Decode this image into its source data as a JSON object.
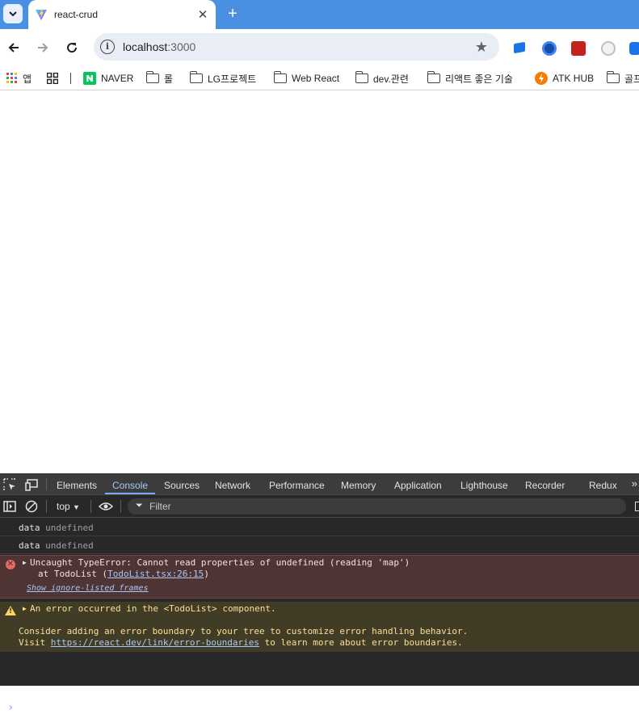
{
  "browser": {
    "tab": {
      "title": "react-crud"
    },
    "address": {
      "host": "localhost",
      "port": ":3000"
    }
  },
  "bookmarks": [
    {
      "label": "앱",
      "icon": "apps-grid-icon"
    },
    {
      "label": "",
      "icon": "tab-groups-icon"
    },
    {
      "label": "NAVER",
      "icon": "naver-icon"
    },
    {
      "label": "롤",
      "icon": "folder-icon"
    },
    {
      "label": "LG프로젝트",
      "icon": "folder-icon"
    },
    {
      "label": "Web React",
      "icon": "folder-icon"
    },
    {
      "label": "dev.관련",
      "icon": "folder-icon"
    },
    {
      "label": "리액트 좋은 기술",
      "icon": "folder-icon"
    },
    {
      "label": "ATK HUB",
      "icon": "atk-icon"
    },
    {
      "label": "골프",
      "icon": "folder-icon"
    }
  ],
  "devtools": {
    "tabs": [
      "Elements",
      "Console",
      "Sources",
      "Network",
      "Performance",
      "Memory",
      "Application",
      "Lighthouse",
      "Recorder",
      "Redux"
    ],
    "active_tab": "Console",
    "context": "top",
    "filter_placeholder": "Filter",
    "logs": [
      {
        "key": "data",
        "value": "undefined"
      },
      {
        "key": "data",
        "value": "undefined"
      }
    ],
    "error": {
      "message": "Uncaught TypeError: Cannot read properties of undefined (reading 'map')",
      "at_prefix": "at TodoList (",
      "location": "TodoList.tsx:26:15",
      "at_suffix": ")",
      "ignore_link": "Show ignore-listed frames"
    },
    "warning": {
      "line1": "An error occurred in the <TodoList> component.",
      "line2": "Consider adding an error boundary to your tree to customize error handling behavior.",
      "line3_prefix": "Visit ",
      "line3_link": "https://react.dev/link/error-boundaries",
      "line3_suffix": " to learn more about error boundaries."
    },
    "prompt": "›"
  }
}
